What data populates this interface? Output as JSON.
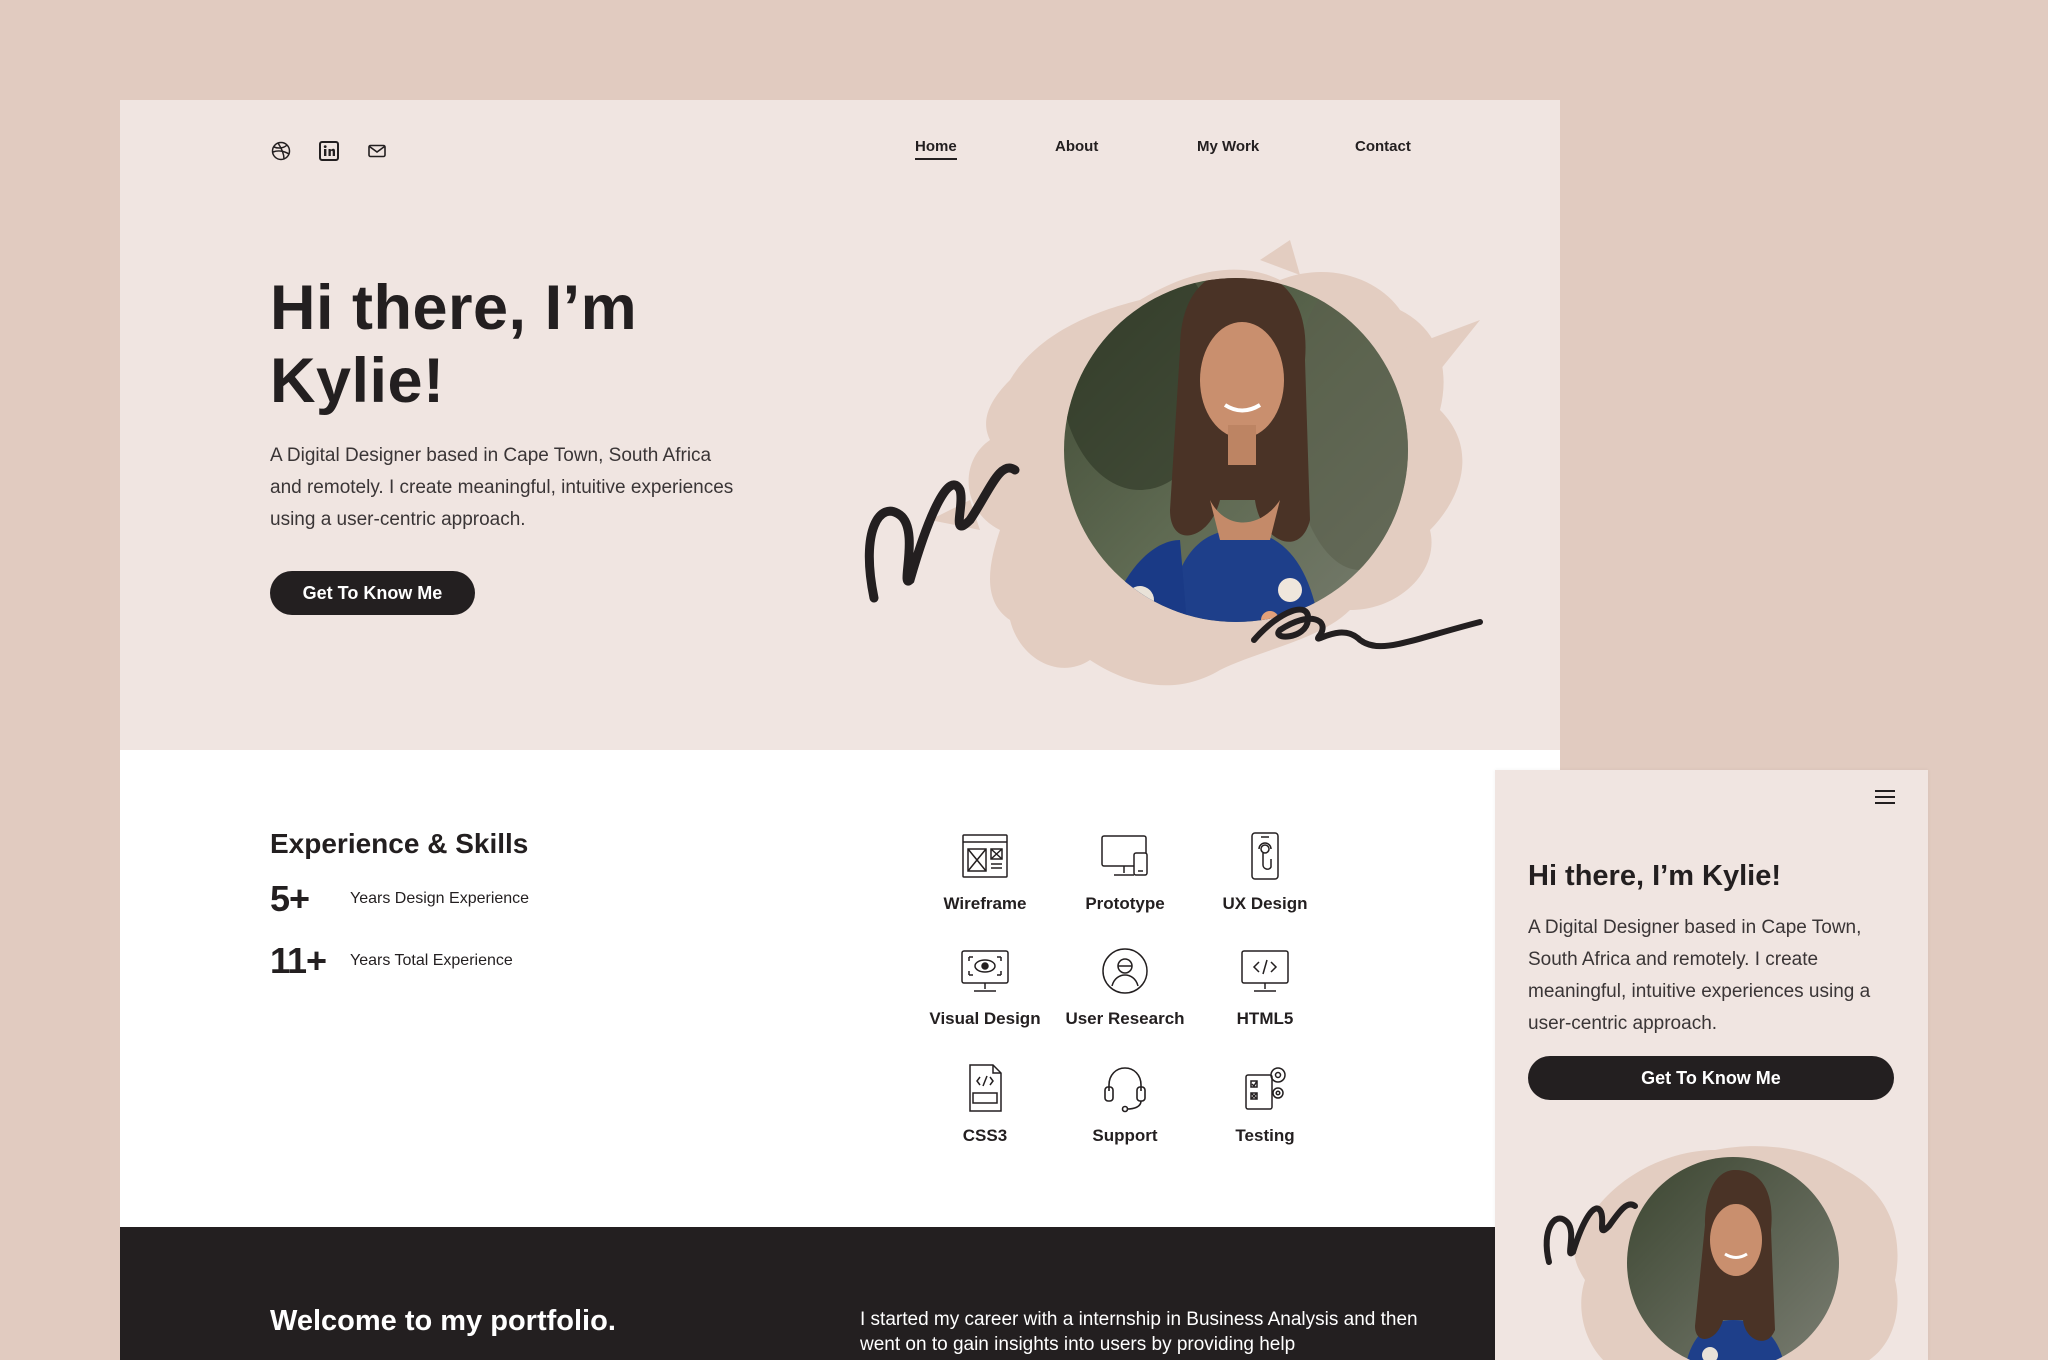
{
  "colors": {
    "page_bg": "#e1cbc0",
    "hero_bg": "#f0e5e1",
    "dark": "#231f20",
    "splash": "#e3cdc1"
  },
  "social": [
    {
      "icon": "dribbble-icon"
    },
    {
      "icon": "linkedin-icon"
    },
    {
      "icon": "mail-icon"
    }
  ],
  "nav": {
    "home": "Home",
    "about": "About",
    "work": "My Work",
    "contact": "Contact"
  },
  "hero": {
    "line1": "Hi there, I’m",
    "line2": "Kylie!",
    "description": "A Digital Designer based in Cape Town, South Africa and remotely. I create meaningful, intuitive experiences using a user-centric approach.",
    "cta": "Get To Know Me",
    "photo_alt": "Kylie"
  },
  "experience": {
    "title": "Experience & Skills",
    "stats": [
      {
        "value": "5+",
        "label": "Years Design Experience"
      },
      {
        "value": "11+",
        "label": "Years Total Experience"
      }
    ]
  },
  "skills": [
    {
      "label": "Wireframe",
      "icon": "wireframe-icon"
    },
    {
      "label": "Prototype",
      "icon": "prototype-icon"
    },
    {
      "label": "UX Design",
      "icon": "ux-design-icon"
    },
    {
      "label": "Visual Design",
      "icon": "visual-design-icon"
    },
    {
      "label": "User Research",
      "icon": "user-research-icon"
    },
    {
      "label": "HTML5",
      "icon": "html5-icon"
    },
    {
      "label": "CSS3",
      "icon": "css3-icon"
    },
    {
      "label": "Support",
      "icon": "support-icon"
    },
    {
      "label": "Testing",
      "icon": "testing-icon"
    }
  ],
  "footer": {
    "welcome": "Welcome to my portfolio.",
    "about": "I started my career with a internship in Business Analysis and then went on to gain insights into users by providing help"
  },
  "mobile": {
    "title": "Hi there, I’m Kylie!",
    "description": "A Digital Designer based in Cape Town, South Africa and remotely. I create meaningful, intuitive experiences using a user-centric approach.",
    "cta": "Get To Know Me",
    "menu_icon": "hamburger-menu-icon"
  }
}
